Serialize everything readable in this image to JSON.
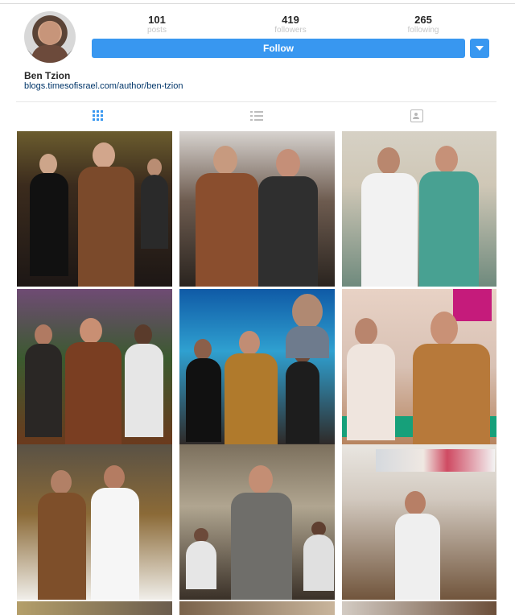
{
  "profile": {
    "username": "Ben Tzion",
    "website": "blogs.timesofisrael.com/author/ben-tzion",
    "follow_label": "Follow"
  },
  "stats": {
    "posts": {
      "value": "101",
      "label": "posts"
    },
    "followers": {
      "value": "419",
      "label": "followers"
    },
    "following": {
      "value": "265",
      "label": "following"
    }
  },
  "tabs": [
    {
      "icon": "grid-icon"
    },
    {
      "icon": "list-icon"
    },
    {
      "icon": "tagged-icon"
    }
  ],
  "colors": {
    "accent": "#3897f0",
    "divider": "#e6e6e6",
    "text": "#262626",
    "muted": "#c7c7c7",
    "link": "#003569"
  }
}
